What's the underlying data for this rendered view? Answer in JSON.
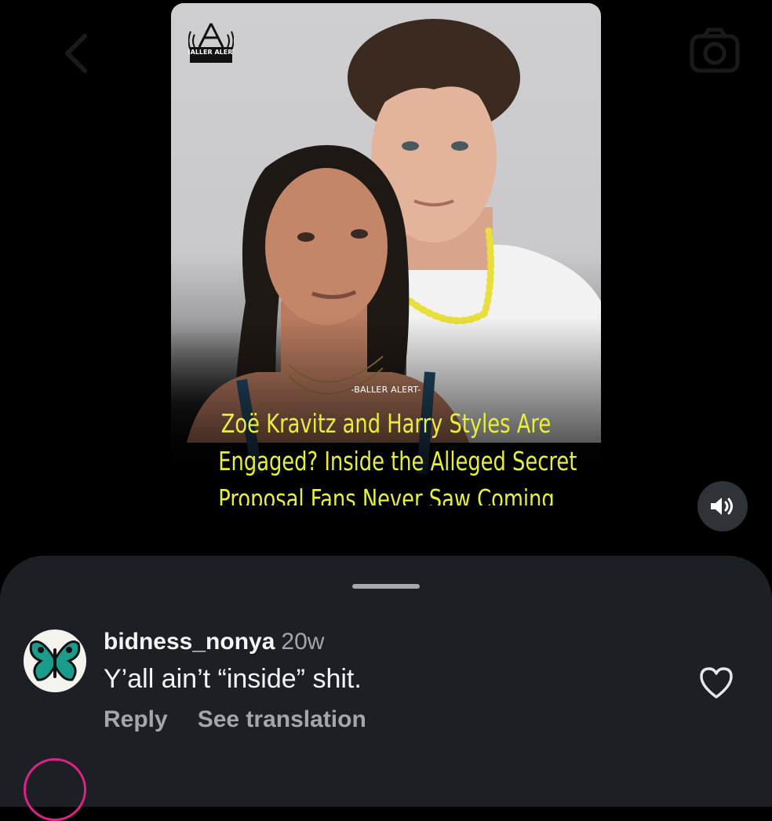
{
  "post": {
    "logo_text": "BALLER ALERT",
    "watermark": "-BALLER ALERT-",
    "headline": [
      "Zoë Kravitz and Harry Styles Are",
      "Engaged? Inside the Alleged Secret",
      "Proposal Fans Never Saw Coming"
    ]
  },
  "icons": {
    "back": "chevron-left-icon",
    "camera": "camera-icon",
    "sound": "speaker-icon",
    "like": "heart-icon"
  },
  "comment": {
    "username": "bidness_nonya",
    "time": "20w",
    "text": "Y’all ain’t “inside” shit.",
    "reply_label": "Reply",
    "translate_label": "See translation"
  },
  "colors": {
    "headline": "#e7ef3b",
    "sheet": "#1c1f24",
    "secondary_text": "#a3a6ab",
    "story_ring": "#e0218a"
  }
}
